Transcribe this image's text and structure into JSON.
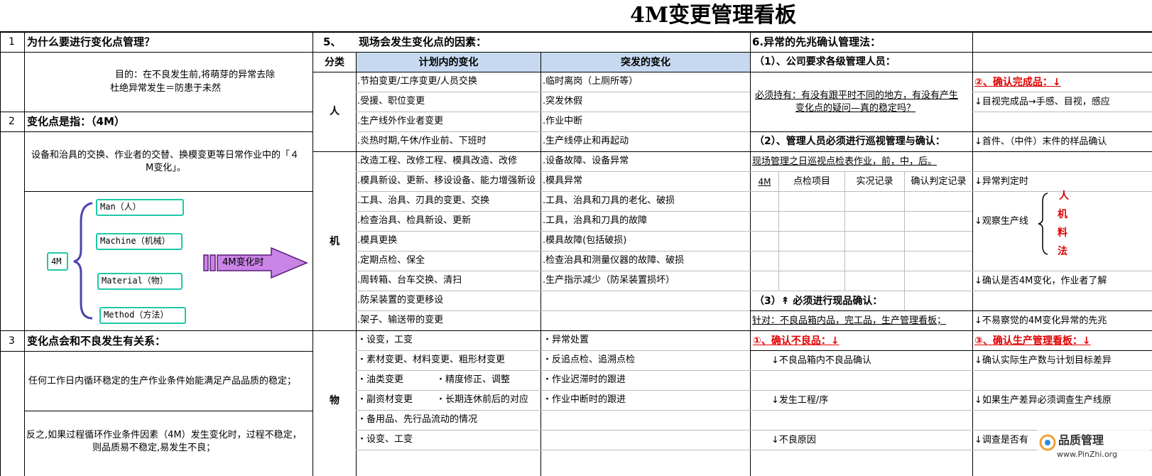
{
  "title": "4M变更管理看板",
  "col1": {
    "r1_num": "1",
    "r1_head": "为什么要进行变化点管理？",
    "r1_text1": "目的：在不良发生前,将萌芽的异常去除",
    "r1_text2": "杜绝异常发生＝防患于未然",
    "r2_num": "2",
    "r2_head": "变化点是指：（4M）",
    "r2_text1": "设备和治具的交换、作业者的交替、换模变更等日常作业中的「４",
    "r2_text2": "M变化」。",
    "diagram": {
      "center": "4M",
      "items": [
        "Man（人）",
        "Machine（机械）",
        "Material（物）",
        "Method（方法）"
      ],
      "arrow": "4M变化时"
    },
    "r3_num": "3",
    "r3_head": "变化点会和不良发生有关系：",
    "r3_text1": "任何工作日内循环稳定的生产作业条件始能满足产品品质的稳定；",
    "r3_text2a": "反之,如果过程循环作业条件因素（4M）发生变化时，过程不稳定，",
    "r3_text2b": "则品质易不稳定,易发生不良；"
  },
  "col2": {
    "num": "5、",
    "head": "现场会发生变化点的因素：",
    "cat_head": "分类",
    "planned_head": "计划内的变化",
    "sudden_head": "突发的变化",
    "groups": [
      {
        "cat": "人",
        "planned": [
          ".节拍变更/工序变更/人员交换",
          ".受援、职位变更",
          ".生产线外作业者变更",
          ".炎热时期,午休/作业前、下班时"
        ],
        "sudden": [
          ".临时离岗（上厕所等）",
          ".突发休假",
          ".作业中断",
          ".生产线停止和再起动"
        ]
      },
      {
        "cat": "机",
        "planned": [
          ".改造工程、改修工程、模具改造、改修",
          ".模具新设、更新、移设设备、能力增强新设",
          ".工具、治具、刃具的变更、交换",
          ".检查治具、检具新设、更新",
          ".模具更换",
          ".定期点检、保全",
          ".周转箱、台车交换、清扫",
          ".防呆装置的变更移设",
          ".架子、输送带的变更"
        ],
        "sudden": [
          ".设备故障、设备异常",
          ".模具异常",
          ".工具、治具和刀具的老化、破损",
          ".工具，治具和刀具的故障",
          ".模具故障(包括破损)",
          ".检查治具和测量仪器的故障、破损",
          ".生产指示减少（防呆装置损坏）",
          "",
          ""
        ]
      },
      {
        "cat": "物",
        "planned": [
          "・设变，工变",
          "・素材变更、材料变更、粗形材变更",
          "・油类变更",
          "・副资材变更",
          "・备用品、先行品流动的情况",
          "・设变、工变"
        ],
        "planned_extra": [
          "・精度修正、调整",
          "・长期连休前后的对应"
        ],
        "sudden": [
          "・异常处置",
          "・反追点检、追溯点检",
          "・作业迟滞时的跟进",
          "・作业中断时的跟进",
          "",
          ""
        ]
      }
    ]
  },
  "col3": {
    "head": "6.异常的先兆确认管理法：",
    "s1": "（1）、公司要求各级管理人员：",
    "s1_text1": "必须持有：有没有跟平时不同的地方，有没有产生",
    "s1_text2": "变化点的疑问—真的稳定吗？",
    "s2": "（2）、管理人员必须进行巡视管理与确认：",
    "s2_text": "现场管理之日巡视点检表作业，前，中，后。",
    "table_head": [
      "4M",
      "点检项目",
      "实况记录",
      "确认判定记录"
    ],
    "s3": "（3）↟ 必须进行现品确认：",
    "s3_text": "针对：不良品箱内品，完工品，生产管理看板；",
    "c1": "①、确认不良品：↓",
    "c1_items": [
      "↓不良品箱内不良品确认",
      "↓发生工程/序",
      "↓不良原因"
    ]
  },
  "col4": {
    "c2": "②、确认完成品：↓",
    "items": [
      "↓目视完成品→手感、目视，感应",
      "↓首件、（中件）末件的样品确认",
      "↓异常判定时",
      "↓观察生产线",
      "↓确认是否4M变化，作业者了解",
      "↓不易察觉的4M变化异常的先兆"
    ],
    "brace_items": [
      "人",
      "机",
      "料",
      "法"
    ],
    "c3": "③、确认生产管理看板：↓",
    "c3_items": [
      "↓确认实际生产数与计划目标差异",
      "↓如果生产差异必须调查生产线原",
      "↓调查是否有"
    ]
  },
  "watermark": {
    "name": "品质管理",
    "url": "www.PinZhi.org"
  }
}
